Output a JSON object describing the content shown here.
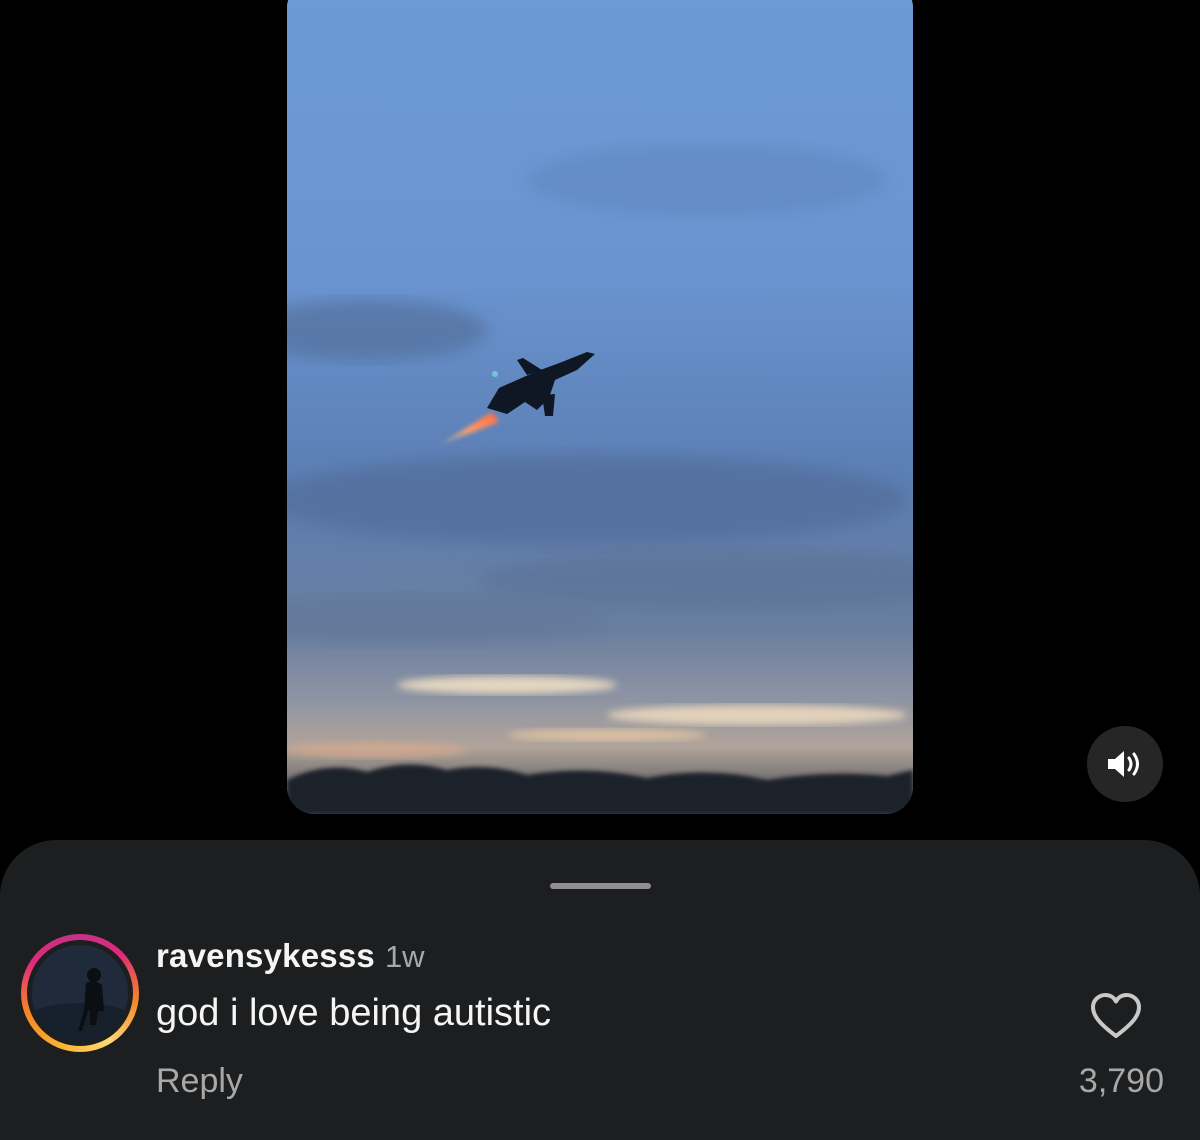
{
  "media": {
    "type": "video",
    "description_icon": "jet-video-frame",
    "mute_icon": "speaker-volume-icon"
  },
  "comment": {
    "username": "ravensykesss",
    "timestamp": "1w",
    "text": "god i love being autistic",
    "reply_label": "Reply",
    "like_count": "3,790",
    "like_icon": "heart-outline-icon"
  },
  "colors": {
    "background": "#000000",
    "sheet": "#1c1e20",
    "primary_text": "#f5f5f5",
    "secondary_text": "#a8a8a8",
    "story_ring_start": "#f9b233",
    "story_ring_end": "#c13584"
  }
}
